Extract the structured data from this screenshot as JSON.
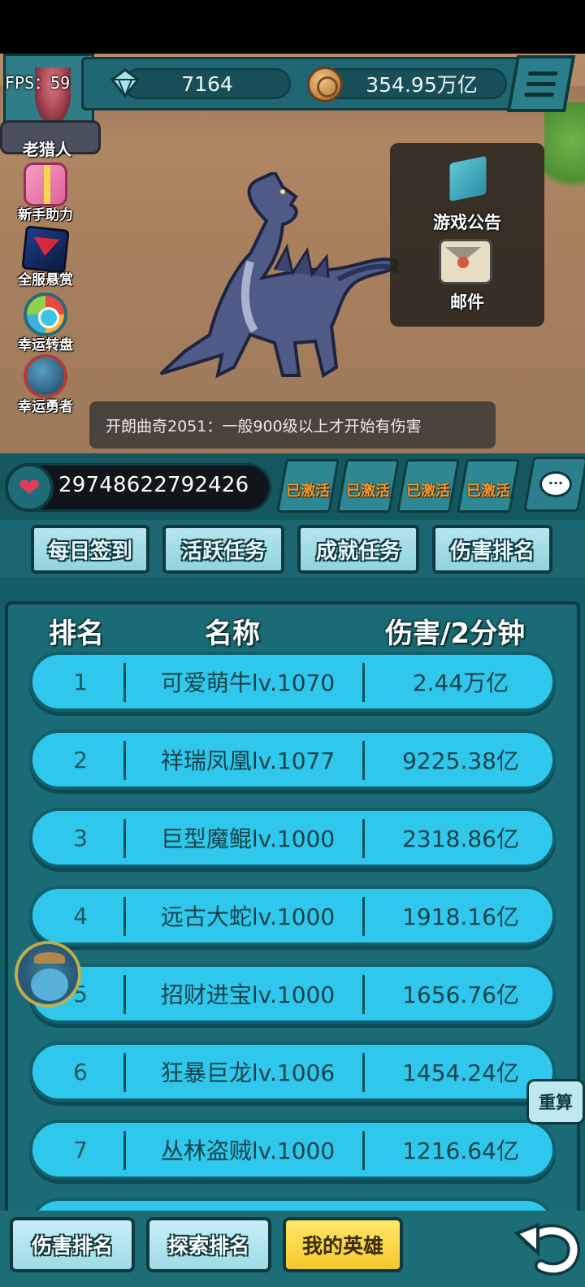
{
  "hud": {
    "fps_label": "FPS：59",
    "gems": "7164",
    "gold": "354.95万亿",
    "player_name": "老猎人"
  },
  "side_menu": [
    {
      "label": "新手助力",
      "icon": "gift-icon"
    },
    {
      "label": "全服悬赏",
      "icon": "bounty-icon"
    },
    {
      "label": "幸运转盘",
      "icon": "wheel-icon"
    },
    {
      "label": "幸运勇者",
      "icon": "hero-icon"
    }
  ],
  "popup": {
    "notice_label": "游戏公告",
    "mail_label": "邮件"
  },
  "chat": {
    "message": "开朗曲奇2051：一般900级以上才开始有伤害"
  },
  "hp": {
    "value": "29748622792426"
  },
  "buffs": [
    "已激活",
    "已激活",
    "已激活",
    "已激活"
  ],
  "task_tabs": [
    "每日签到",
    "活跃任务",
    "成就任务",
    "伤害排名"
  ],
  "ranking": {
    "headers": {
      "rank": "排名",
      "name": "名称",
      "damage": "伤害/2分钟"
    },
    "rows": [
      {
        "rank": "1",
        "name": "可爱萌牛lv.1070",
        "damage": "2.44万亿"
      },
      {
        "rank": "2",
        "name": "祥瑞凤凰lv.1077",
        "damage": "9225.38亿"
      },
      {
        "rank": "3",
        "name": "巨型魔鲲lv.1000",
        "damage": "2318.86亿"
      },
      {
        "rank": "4",
        "name": "远古大蛇lv.1000",
        "damage": "1918.16亿"
      },
      {
        "rank": "5",
        "name": "招财进宝lv.1000",
        "damage": "1656.76亿"
      },
      {
        "rank": "6",
        "name": "狂暴巨龙lv.1006",
        "damage": "1454.24亿"
      },
      {
        "rank": "7",
        "name": "丛林盗贼lv.1000",
        "damage": "1216.64亿"
      }
    ],
    "recalc_label": "重算"
  },
  "bottom_nav": {
    "damage_rank": "伤害排名",
    "explore_rank": "探索排名",
    "my_heroes": "我的英雄"
  },
  "colors": {
    "row_fill": "#2fc8ec",
    "panel": "#1a6b75",
    "active_tab": "#f5c82d",
    "buff_text": "#f29a2e"
  }
}
